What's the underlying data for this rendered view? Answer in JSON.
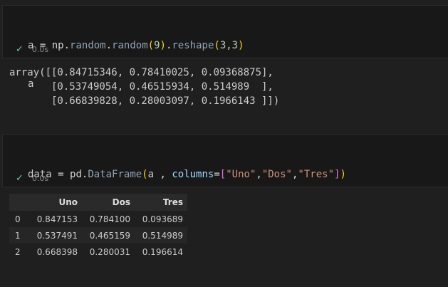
{
  "cell1": {
    "line1": {
      "var": "a",
      "eq": " = ",
      "mod": "np",
      "dot1": ".",
      "fn1": "random",
      "dot2": ".",
      "fn2": "random",
      "lp": "(",
      "arg": "9",
      "rp": ")",
      "dot3": ".",
      "fn3": "reshape",
      "lp2": "(",
      "args": "3,3",
      "rp2": ")"
    },
    "line2": "a",
    "status_time": "0.0s"
  },
  "output1": {
    "lines": [
      "array([[0.84715346, 0.78410025, 0.09368875],",
      "       [0.53749054, 0.46515934, 0.514989  ],",
      "       [0.66839828, 0.28003097, 0.1966143 ]])"
    ]
  },
  "cell2": {
    "line1": {
      "var": "data",
      "eq": " = ",
      "mod": "pd",
      "dot": ".",
      "cls": "DataFrame",
      "lp": "(",
      "arg": "a",
      "comma": " , ",
      "param": "columns",
      "eq2": "=",
      "lb": "[",
      "s1": "\"Uno\"",
      "c1": ",",
      "s2": "\"Dos\"",
      "c2": ",",
      "s3": "\"Tres\"",
      "rb": "]",
      "rp": ")"
    },
    "line2": "data",
    "status_time": "0.0s"
  },
  "dataframe": {
    "columns": [
      "",
      "Uno",
      "Dos",
      "Tres"
    ],
    "rows": [
      {
        "index": "0",
        "values": [
          "0.847153",
          "0.784100",
          "0.093689"
        ]
      },
      {
        "index": "1",
        "values": [
          "0.537491",
          "0.465159",
          "0.514989"
        ]
      },
      {
        "index": "2",
        "values": [
          "0.668398",
          "0.280031",
          "0.196614"
        ]
      }
    ]
  },
  "icons": {
    "check": "✓"
  },
  "colors": {
    "background": "#1f1f1f",
    "cell_background": "#181818",
    "success_check": "#73c991"
  }
}
